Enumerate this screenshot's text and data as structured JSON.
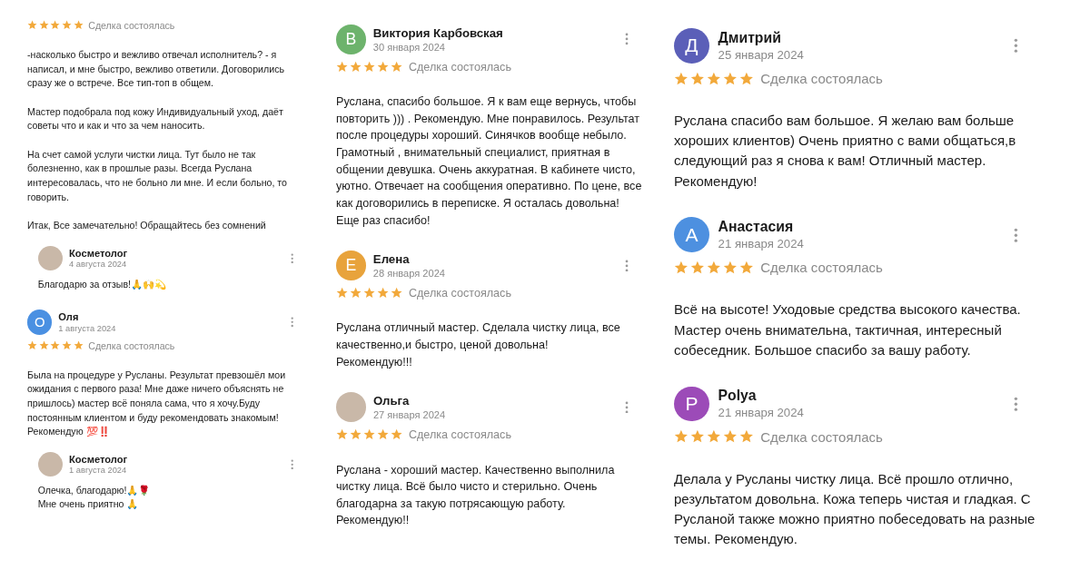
{
  "columns": [
    {
      "items": [
        {
          "kind": "rating",
          "stars": 5,
          "status": "Сделка состоялась",
          "text": "-насколько быстро и вежливо отвечал исполнитель? - я написал, и мне быстро, вежливо ответили. Договорились сразу же о встрече. Все тип-топ в общем.\n\nМастер подобрала под кожу Индивидуальный уход, даёт советы что и как и что за чем наносить.\n\nНа счет самой услуги чистки лица. Тут было не так болезненно, как в прошлые разы. Всегда Руслана интересовалась, что не больно ли мне. И если больно, то говорить.\n\nИтак, Все замечательно! Обращайтесь без сомнений"
        },
        {
          "kind": "reply",
          "avatar": {
            "kind": "photo"
          },
          "author": "Косметолог",
          "date": "4 августа 2024",
          "text": "Благодарю за отзыв!🙏🙌💫"
        },
        {
          "kind": "review",
          "avatar": {
            "kind": "letter",
            "letter": "О",
            "color": "#4a90e2"
          },
          "author": "Оля",
          "date": "1 августа 2024",
          "stars": 5,
          "status": "Сделка состоялась",
          "text": "Была на процедуре у Русланы. Результат превзошёл мои ожидания с первого раза! Мне даже ничего объяснять не пришлось) мастер всё поняла сама, что я хочу.Буду  постоянным клиентом и буду рекомендовать знакомым!\nРекомендую 💯‼️"
        },
        {
          "kind": "reply",
          "avatar": {
            "kind": "photo"
          },
          "author": "Косметолог",
          "date": "1 августа 2024",
          "text": "Олечка, благодарю!🙏🌹\nМне очень приятно 🙏"
        }
      ]
    },
    {
      "items": [
        {
          "kind": "review",
          "avatar": {
            "kind": "letter",
            "letter": "В",
            "color": "#6db36c"
          },
          "author": "Виктория Карбовская",
          "date": "30 января 2024",
          "stars": 5,
          "status": "Сделка состоялась",
          "text": "Руслана, спасибо большое. Я к вам еще вернусь, чтобы повторить ))) . Рекомендую. Мне понравилось. Результат после процедуры хороший. Синячков вообще небыло.  Грамотный , внимательный специалист, приятная в общении девушка. Очень аккуратная. В кабинете чисто, уютно. Отвечает на сообщения оперативно. По цене, все как договорились в переписке. Я осталась довольна! Еще раз спасибо!"
        },
        {
          "kind": "review",
          "avatar": {
            "kind": "letter",
            "letter": "Е",
            "color": "#e8a33c"
          },
          "author": "Елена",
          "date": "28 января 2024",
          "stars": 5,
          "status": "Сделка состоялась",
          "text": "Руслана отличный мастер. Сделала чистку лица, все качественно,и быстро, ценой довольна!\nРекомендую!!!"
        },
        {
          "kind": "review",
          "avatar": {
            "kind": "photo"
          },
          "author": "Ольга",
          "date": "27 января 2024",
          "stars": 5,
          "status": "Сделка состоялась",
          "text": "Руслана - хороший мастер. Качественно выполнила чистку лица. Всё было чисто и стерильно. Очень благодарна за такую потрясающую работу.\nРекомендую!!"
        }
      ]
    },
    {
      "items": [
        {
          "kind": "review",
          "avatar": {
            "kind": "letter",
            "letter": "Д",
            "color": "#5b5fb8"
          },
          "author": "Дмитрий",
          "date": "25 января 2024",
          "stars": 5,
          "status": "Сделка состоялась",
          "text": "Руслана спасибо вам большое. Я желаю вам больше хороших клиентов) Очень приятно с вами общаться,в следующий раз я снова к вам! Отличный мастер. Рекомендую!"
        },
        {
          "kind": "review",
          "avatar": {
            "kind": "letter",
            "letter": "А",
            "color": "#4d90e0"
          },
          "author": "Анастасия",
          "date": "21 января 2024",
          "stars": 5,
          "status": "Сделка состоялась",
          "text": "Всё на высоте! Уходовые средства высокого качества. Мастер очень внимательна, тактичная, интересный собеседник. Большое спасибо за вашу работу."
        },
        {
          "kind": "review",
          "avatar": {
            "kind": "letter",
            "letter": "P",
            "color": "#9c4bb8"
          },
          "author": "Polya",
          "date": "21 января 2024",
          "stars": 5,
          "status": "Сделка состоялась",
          "text": "Делала у Русланы чистку лица. Всё прошло отлично, результатом довольна. Кожа теперь чистая и гладкая. С Русланой также можно приятно побеседовать на разные темы. Рекомендую."
        }
      ]
    }
  ]
}
